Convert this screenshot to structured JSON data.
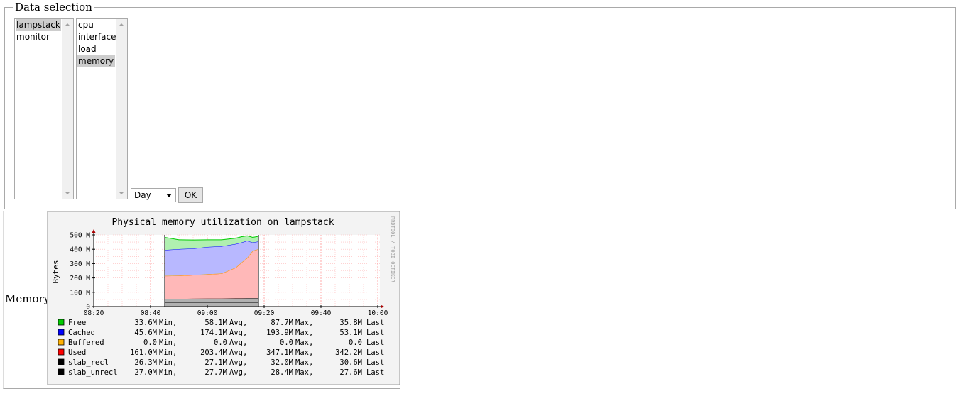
{
  "data_selection": {
    "legend": "Data selection",
    "hosts": {
      "items": [
        "lampstack",
        "monitor"
      ],
      "selected": "lampstack"
    },
    "plugins": {
      "items": [
        "cpu",
        "interface",
        "load",
        "memory"
      ],
      "selected": "memory"
    },
    "period": {
      "value": "Day"
    },
    "ok_label": "OK"
  },
  "graphs": [
    {
      "row_label": "Memory",
      "title": "Physical memory utilization on lampstack",
      "ylabel": "Bytes",
      "watermark": "RRDTOOL / TOBI OETIKER",
      "colors": {
        "Free": "#00cc00",
        "Cached": "#0000ff",
        "Buffered": "#ffb000",
        "Used": "#ff0000",
        "slab_recl": "#000000",
        "slab_unrecl": "#000000",
        "free_fill": "#b0f0b0",
        "cached_fill": "#b8b8ff",
        "used_fill": "#ffb8b8",
        "slab_fill": "#b0b0b0",
        "grid": "#ff9999",
        "axis_arrow": "#aa0000"
      },
      "chart_data": {
        "type": "area",
        "title": "Physical memory utilization on lampstack",
        "xlabel": "",
        "ylabel": "Bytes",
        "x_ticks": [
          "08:20",
          "08:40",
          "09:00",
          "09:20",
          "09:40",
          "10:00"
        ],
        "y_ticks": [
          "500 M",
          "400 M",
          "300 M",
          "200 M",
          "100 M",
          "0"
        ],
        "ylim": [
          0,
          500
        ],
        "stacked": true,
        "x": [
          "08:45",
          "08:50",
          "08:55",
          "09:00",
          "09:05",
          "09:10",
          "09:12",
          "09:14",
          "09:16",
          "09:18"
        ],
        "series": [
          {
            "name": "slab_unrecl",
            "values": [
              27,
              27,
              27,
              28,
              28,
              28,
              28,
              28,
              28,
              28
            ]
          },
          {
            "name": "slab_recl",
            "values": [
              27,
              27,
              28,
              28,
              28,
              29,
              29,
              31,
              31,
              31
            ]
          },
          {
            "name": "Used",
            "values": [
              161,
              162,
              165,
              170,
              175,
              215,
              250,
              280,
              330,
              342
            ]
          },
          {
            "name": "Buffered",
            "values": [
              0,
              0,
              0,
              0,
              0,
              0,
              0,
              0,
              0,
              0
            ]
          },
          {
            "name": "Cached",
            "values": [
              180,
              185,
              185,
              190,
              190,
              165,
              140,
              120,
              58,
              53
            ]
          },
          {
            "name": "Free",
            "values": [
              88,
              65,
              60,
              50,
              45,
              40,
              40,
              35,
              36,
              36
            ]
          }
        ]
      },
      "legend": [
        {
          "name": "Free",
          "min": "33.6M",
          "avg": "58.1M",
          "max": "87.7M",
          "last": "35.8M"
        },
        {
          "name": "Cached",
          "min": "45.6M",
          "avg": "174.1M",
          "max": "193.9M",
          "last": "53.1M"
        },
        {
          "name": "Buffered",
          "min": "0.0",
          "avg": "0.0",
          "max": "0.0",
          "last": "0.0"
        },
        {
          "name": "Used",
          "min": "161.0M",
          "avg": "203.4M",
          "max": "347.1M",
          "last": "342.2M"
        },
        {
          "name": "slab_recl",
          "min": "26.3M",
          "avg": "27.1M",
          "max": "32.0M",
          "last": "30.6M"
        },
        {
          "name": "slab_unrecl",
          "min": "27.0M",
          "avg": "27.7M",
          "max": "28.4M",
          "last": "27.6M"
        }
      ],
      "legend_words": {
        "min": "Min,",
        "avg": "Avg,",
        "max": "Max,",
        "last": "Last"
      }
    }
  ]
}
